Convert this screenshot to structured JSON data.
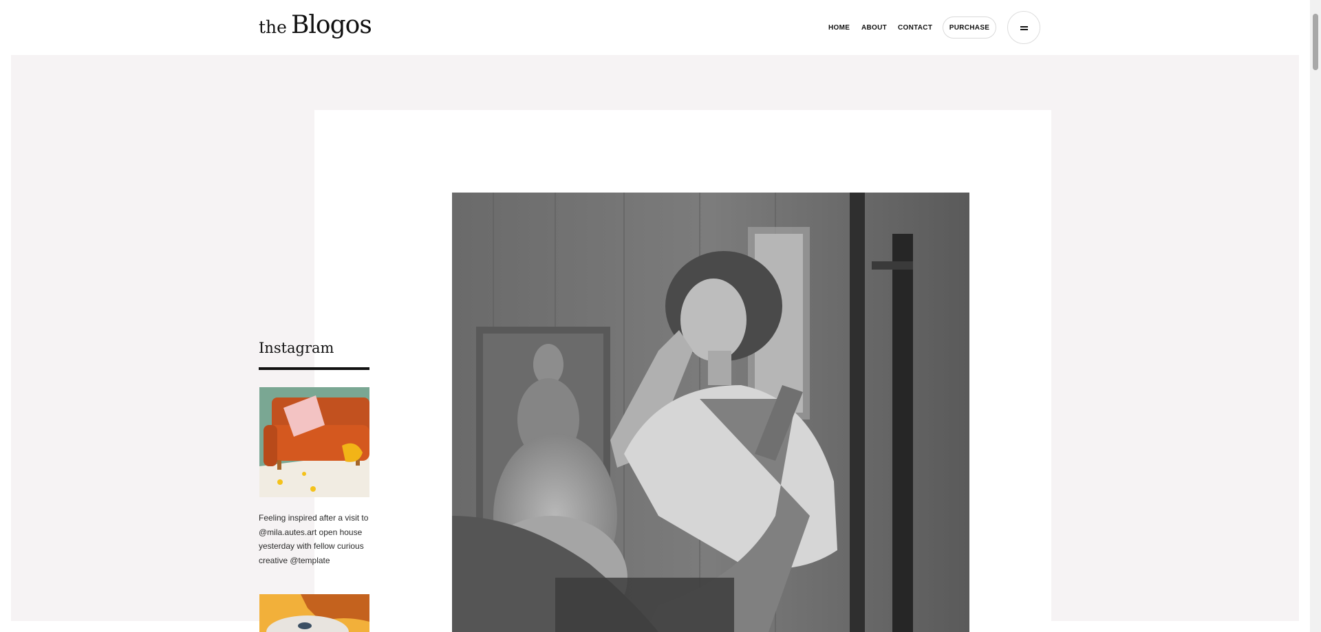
{
  "header": {
    "logo_prefix": "the",
    "logo_name": "Blogos",
    "nav": {
      "home": "HOME",
      "about": "ABOUT",
      "contact": "CONTACT"
    },
    "purchase_label": "PURCHASE",
    "menu_icon": "hamburger-icon"
  },
  "sidebar": {
    "instagram_title": "Instagram",
    "post_caption": "Feeling inspired after a visit to @mila.autes.art open house yesterday with fellow curious creative @template"
  },
  "colors": {
    "hero_background": "#f6f3f4",
    "card_background": "#ffffff",
    "text": "#111111"
  }
}
